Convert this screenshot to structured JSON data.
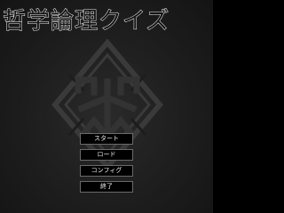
{
  "title": "哲学論理クイズ",
  "menu": {
    "items": [
      {
        "label": "スタート"
      },
      {
        "label": "ロード"
      },
      {
        "label": "コンフィグ"
      },
      {
        "label": "終了"
      }
    ]
  },
  "colors": {
    "background": "#1d1d1d",
    "title_outline": "#f2f2f2",
    "button_background": "#000000",
    "button_border": "#6a6a6a",
    "emblem": "#3a3a3a"
  }
}
